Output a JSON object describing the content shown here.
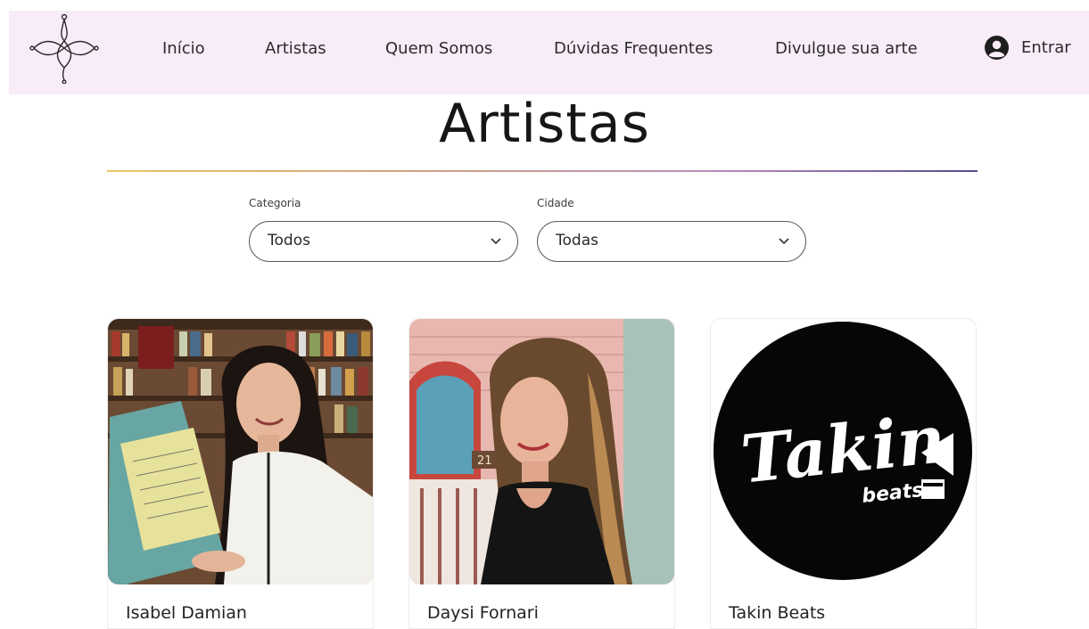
{
  "header": {
    "nav": [
      {
        "label": "Início"
      },
      {
        "label": "Artistas"
      },
      {
        "label": "Quem Somos"
      },
      {
        "label": "Dúvidas Frequentes"
      },
      {
        "label": "Divulgue sua arte"
      }
    ],
    "login_label": "Entrar"
  },
  "page": {
    "title": "Artistas"
  },
  "filters": {
    "category": {
      "label": "Categoria",
      "value": "Todos"
    },
    "city": {
      "label": "Cidade",
      "value": "Todas"
    }
  },
  "artists": [
    {
      "name": "Isabel Damian"
    },
    {
      "name": "Daysi Fornari"
    },
    {
      "name": "Takin Beats"
    }
  ],
  "logos": {
    "takin_beats": {
      "wordmark": "Takin",
      "subtitle": "beats"
    }
  },
  "colors": {
    "header_bg": "#f8ecf8",
    "divider_start": "#e9c763",
    "divider_end": "#564a93",
    "text": "#1c1c1c"
  }
}
